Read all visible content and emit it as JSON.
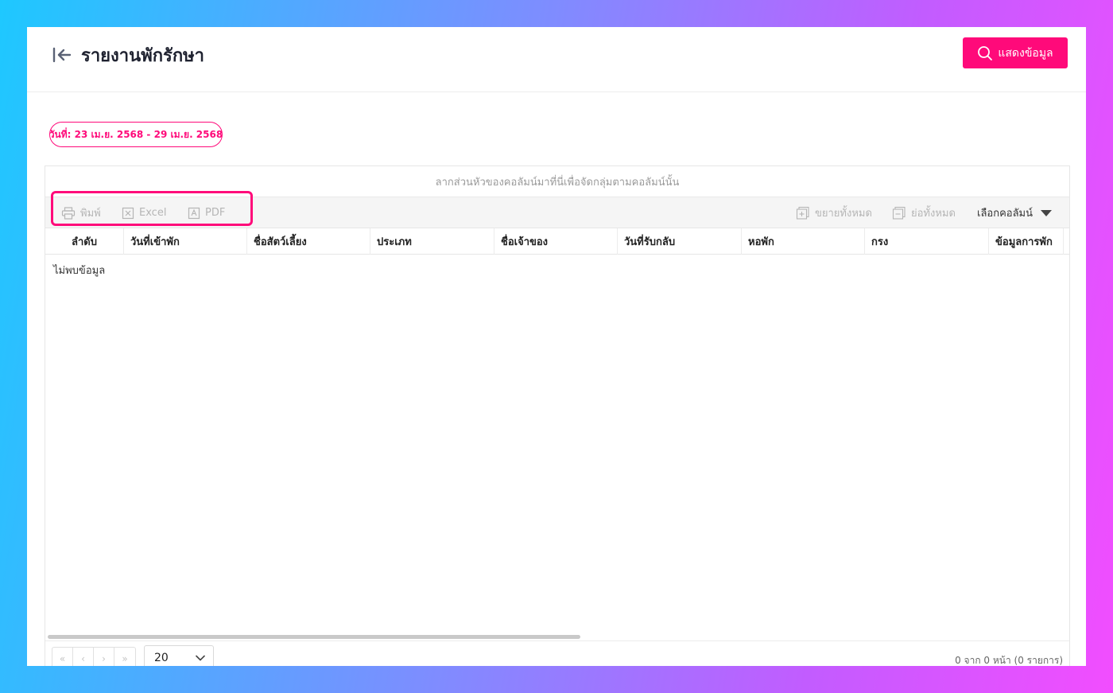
{
  "header": {
    "title": "รายงานพักรักษา",
    "show_button_label": "แสดงข้อมูล"
  },
  "filter": {
    "date_range": "วันที่: 23 เม.ย. 2568 - 29 เม.ย. 2568"
  },
  "grid": {
    "group_panel_text": "ลากส่วนหัวของคอลัมน์มาที่นี่เพื่อจัดกลุ่มตามคอลัมน์นั้น",
    "toolbar": {
      "print_label": "พิมพ์",
      "excel_label": "Excel",
      "pdf_label": "PDF",
      "expand_all_label": "ขยายทั้งหมด",
      "collapse_all_label": "ย่อทั้งหมด",
      "column_chooser_label": "เลือกคอลัมน์"
    },
    "columns": [
      "ลำดับ",
      "วันที่เข้าพัก",
      "ชื่อสัตว์เลี้ยง",
      "ประเภท",
      "ชื่อเจ้าของ",
      "วันที่รับกลับ",
      "หอพัก",
      "กรง",
      "ข้อมูลการพัก"
    ],
    "empty_message": "ไม่พบข้อมูล"
  },
  "pagination": {
    "first": "«",
    "prev": "‹",
    "next": "›",
    "last": "»",
    "page_size": "20",
    "info": "0 จาก 0 หน้า (0 รายการ)"
  },
  "colors": {
    "accent": "#ff0a7a",
    "text_muted": "#b5b5b5"
  }
}
